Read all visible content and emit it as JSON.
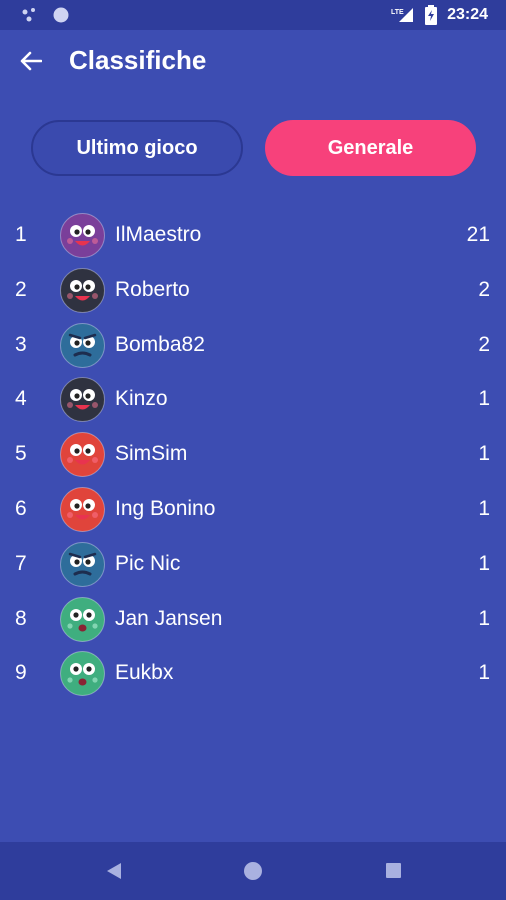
{
  "status": {
    "time": "23:24",
    "network": "LTE"
  },
  "header": {
    "title": "Classifiche"
  },
  "tabs": [
    {
      "label": "Ultimo gioco",
      "selected": false
    },
    {
      "label": "Generale",
      "selected": true
    }
  ],
  "leaderboard": [
    {
      "rank": "1",
      "name": "IlMaestro",
      "score": "21",
      "avatar": "purple-smiley-icon",
      "color": "#7a3f9a"
    },
    {
      "rank": "2",
      "name": "Roberto",
      "score": "2",
      "avatar": "black-smiley-icon",
      "color": "#2f3240"
    },
    {
      "rank": "3",
      "name": "Bomba82",
      "score": "2",
      "avatar": "blue-worried-icon",
      "color": "#2e6d9b"
    },
    {
      "rank": "4",
      "name": "Kinzo",
      "score": "1",
      "avatar": "black-smiley-icon",
      "color": "#2f3240"
    },
    {
      "rank": "5",
      "name": "SimSim",
      "score": "1",
      "avatar": "red-smiley-icon",
      "color": "#e0443b"
    },
    {
      "rank": "6",
      "name": "Ing Bonino",
      "score": "1",
      "avatar": "red-smiley-icon",
      "color": "#e0443b"
    },
    {
      "rank": "7",
      "name": "Pic Nic",
      "score": "1",
      "avatar": "blue-worried-icon",
      "color": "#2e6d9b"
    },
    {
      "rank": "8",
      "name": "Jan Jansen",
      "score": "1",
      "avatar": "green-surprised-icon",
      "color": "#3fae7f"
    },
    {
      "rank": "9",
      "name": "Eukbx",
      "score": "1",
      "avatar": "green-surprised-icon",
      "color": "#3fae7f"
    }
  ],
  "colors": {
    "background": "#3d4db2",
    "accent": "#f7417b",
    "bar": "#2f3d9c"
  }
}
